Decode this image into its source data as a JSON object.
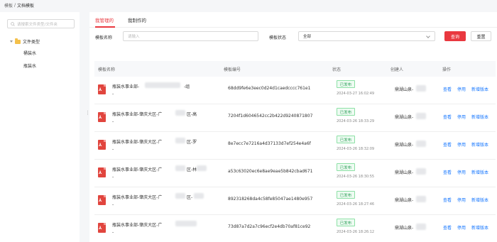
{
  "breadcrumb": {
    "parent": "模板",
    "separator": "/",
    "current": "文档模板"
  },
  "sidebar": {
    "search_placeholder": "请搜索文件类型/文件夹",
    "root": "文件类型",
    "items": [
      {
        "label": "桶装水"
      },
      {
        "label": "瓶装水"
      }
    ]
  },
  "tabs": [
    {
      "label": "我管理的",
      "active": true
    },
    {
      "label": "我制作的",
      "active": false
    }
  ],
  "filters": {
    "name_label": "模板名称",
    "name_placeholder": "请输入",
    "status_label": "模板状态",
    "status_value": "全部",
    "query_label": "查询",
    "reset_label": "重置"
  },
  "table": {
    "columns": [
      "模板名称",
      "模板编号",
      "状态",
      "创建人",
      "操作"
    ],
    "actions": [
      "查看",
      "停用",
      "新增版本"
    ],
    "rows": [
      {
        "name": "瓶装水事业部-",
        "name_tail": "-组",
        "code": "68dd9fe6e3eec0d24d1caedcccc761e1",
        "status": "已发布",
        "time": "2024-03-27 16:02:49",
        "creator": "鼎湖山泉-"
      },
      {
        "name": "瓶装水事业部-肇庆大区-广",
        "name_tail": "区-高",
        "code": "7204f1d6046542cc2b422d9240871807",
        "status": "已发布",
        "time": "2024-03-26 18:33:29",
        "creator": "鼎湖山泉-"
      },
      {
        "name": "瓶装水事业部-肇庆大区-广",
        "name_tail": "区-罗",
        "code": "8e7ecc7e7216a4d37133d7ef254e4a6f",
        "status": "已发布",
        "time": "2024-03-26 18:32:09",
        "creator": "鼎湖山泉-"
      },
      {
        "name": "瓶装水事业部-肇庆大区-广",
        "name_tail": "区-林",
        "code": "a53c63020ec6e8ae9eae5b842cbad671",
        "status": "已发布",
        "time": "2024-03-26 18:30:55",
        "creator": "鼎湖山泉-"
      },
      {
        "name": "瓶装水事业部-肇庆大区-广",
        "name_tail": "区-",
        "code": "892318268da4c58fe85047ae1480e957",
        "status": "已发布",
        "time": "2024-03-26 18:27:46",
        "creator": "鼎湖山泉-"
      },
      {
        "name": "瓶装水事业部-肇庆大区-广",
        "name_tail": "",
        "code": "73d87a7d2a7c96ecf2e4db70af81ce92",
        "status": "已发布",
        "time": "2024-03-26 18:26:12",
        "creator": "鼎湖山泉-"
      }
    ]
  },
  "colors": {
    "accent": "#e9383f",
    "link": "#1677ff",
    "success": "#2ea05a"
  },
  "icons": {
    "search": "search-icon",
    "folder": "folder-icon",
    "pdf": "pdf-icon"
  }
}
